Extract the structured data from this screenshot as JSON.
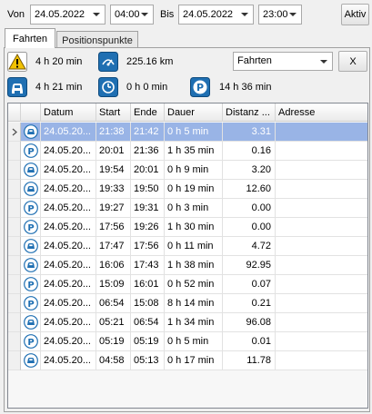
{
  "filter": {
    "von_label": "Von",
    "von_date": "24.05.2022",
    "von_time": "04:00",
    "bis_label": "Bis",
    "bis_date": "24.05.2022",
    "bis_time": "23:00",
    "aktiv_label": "Aktiv"
  },
  "tabs": [
    {
      "label": "Fahrten"
    },
    {
      "label": "Positionspunkte"
    }
  ],
  "summary": {
    "warning_duration": "4 h 20 min",
    "distance_total": "225.16 km",
    "drive_duration": "4 h 21 min",
    "idle_duration": "0 h 0 min",
    "parking_duration": "14 h 36 min",
    "filter_select": "Fahrten",
    "clear_button": "X"
  },
  "table": {
    "columns": [
      "Datum",
      "Start",
      "Ende",
      "Dauer",
      "Distanz ...",
      "Adresse"
    ],
    "rows": [
      {
        "type": "drive",
        "datum": "24.05.20...",
        "start": "21:38",
        "ende": "21:42",
        "dauer": "0 h 5 min",
        "distanz": "3.31",
        "adresse": ""
      },
      {
        "type": "park",
        "datum": "24.05.20...",
        "start": "20:01",
        "ende": "21:36",
        "dauer": "1 h 35 min",
        "distanz": "0.16",
        "adresse": ""
      },
      {
        "type": "drive",
        "datum": "24.05.20...",
        "start": "19:54",
        "ende": "20:01",
        "dauer": "0 h 9 min",
        "distanz": "3.20",
        "adresse": ""
      },
      {
        "type": "drive",
        "datum": "24.05.20...",
        "start": "19:33",
        "ende": "19:50",
        "dauer": "0 h 19 min",
        "distanz": "12.60",
        "adresse": ""
      },
      {
        "type": "park",
        "datum": "24.05.20...",
        "start": "19:27",
        "ende": "19:31",
        "dauer": "0 h 3 min",
        "distanz": "0.00",
        "adresse": ""
      },
      {
        "type": "park",
        "datum": "24.05.20...",
        "start": "17:56",
        "ende": "19:26",
        "dauer": "1 h 30 min",
        "distanz": "0.00",
        "adresse": ""
      },
      {
        "type": "drive",
        "datum": "24.05.20...",
        "start": "17:47",
        "ende": "17:56",
        "dauer": "0 h 11 min",
        "distanz": "4.72",
        "adresse": ""
      },
      {
        "type": "drive",
        "datum": "24.05.20...",
        "start": "16:06",
        "ende": "17:43",
        "dauer": "1 h 38 min",
        "distanz": "92.95",
        "adresse": ""
      },
      {
        "type": "park",
        "datum": "24.05.20...",
        "start": "15:09",
        "ende": "16:01",
        "dauer": "0 h 52 min",
        "distanz": "0.07",
        "adresse": ""
      },
      {
        "type": "park",
        "datum": "24.05.20...",
        "start": "06:54",
        "ende": "15:08",
        "dauer": "8 h 14 min",
        "distanz": "0.21",
        "adresse": ""
      },
      {
        "type": "drive",
        "datum": "24.05.20...",
        "start": "05:21",
        "ende": "06:54",
        "dauer": "1 h 34 min",
        "distanz": "96.08",
        "adresse": ""
      },
      {
        "type": "park",
        "datum": "24.05.20...",
        "start": "05:19",
        "ende": "05:19",
        "dauer": "0 h 5 min",
        "distanz": "0.01",
        "adresse": ""
      },
      {
        "type": "drive",
        "datum": "24.05.20...",
        "start": "04:58",
        "ende": "05:13",
        "dauer": "0 h 17 min",
        "distanz": "11.78",
        "adresse": ""
      }
    ],
    "selected_row": 0
  },
  "colors": {
    "selection": "#99b4e6",
    "icon_blue": "#1f6fb2",
    "warning_yellow": "#f2c200"
  }
}
